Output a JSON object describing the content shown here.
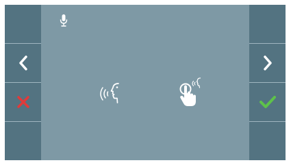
{
  "screen": {
    "colors": {
      "background": "#7e99a5",
      "side_panel": "#537381",
      "divider": "#9fb6c0",
      "icon_white": "#ffffff",
      "cancel_red": "#e03a3a",
      "accept_green": "#5ec24a"
    },
    "status": {
      "icon": "microphone-icon"
    },
    "left_panel": {
      "buttons": [
        "empty",
        "chevron-left-icon",
        "close-icon",
        "empty"
      ]
    },
    "right_panel": {
      "buttons": [
        "empty",
        "chevron-right-icon",
        "check-icon",
        "empty"
      ]
    },
    "center": {
      "icons": [
        "speaking-head-icon",
        "touch-hand-icon"
      ]
    }
  }
}
